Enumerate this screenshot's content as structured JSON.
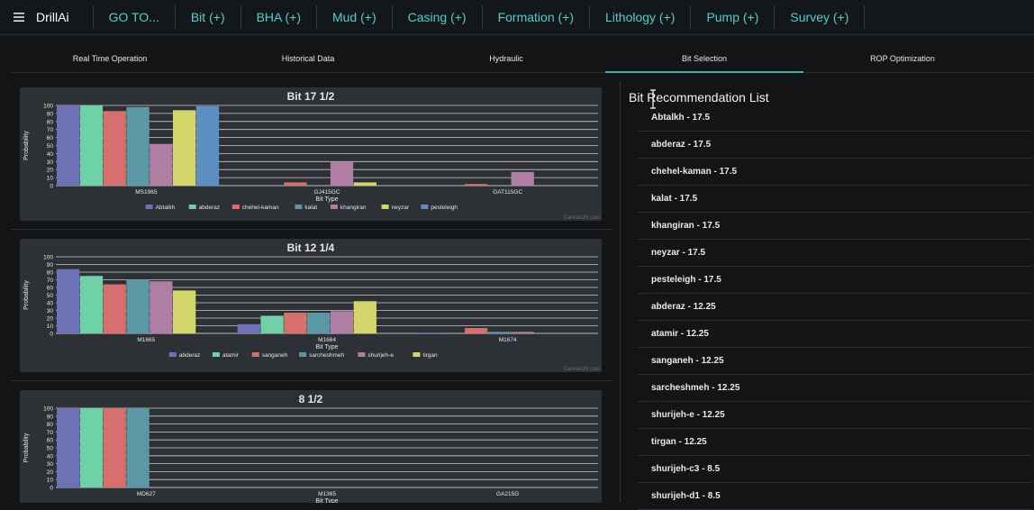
{
  "app": {
    "title": "DrillAi"
  },
  "nav": [
    "GO TO...",
    "Bit (+)",
    "BHA (+)",
    "Mud (+)",
    "Casing (+)",
    "Formation (+)",
    "Lithology (+)",
    "Pump (+)",
    "Survey (+)"
  ],
  "tabs": [
    "Real Time Operation",
    "Historical Data",
    "Hydraulic",
    "Bit Selection",
    "ROP Optimization"
  ],
  "active_tab": "Bit Selection",
  "recommendation": {
    "title": "Bit Recommendation List",
    "items": [
      "Abtalkh - 17.5",
      "abderaz - 17.5",
      "chehel-kaman - 17.5",
      "kalat - 17.5",
      "khangiran - 17.5",
      "neyzar - 17.5",
      "pesteleigh - 17.5",
      "abderaz - 12.25",
      "atamir - 12.25",
      "sanganeh - 12.25",
      "sarcheshmeh - 12.25",
      "shurijeh-e - 12.25",
      "tirgan - 12.25",
      "shurijeh-c3 - 8.5",
      "shurijeh-d1 - 8.5"
    ]
  },
  "colors": {
    "accent": "#4fd1c5",
    "tab_underline": "#38b2ac",
    "chart_bg": "#2d3135"
  },
  "chart_data": [
    {
      "type": "bar",
      "title": "Bit 17 1/2",
      "xlabel": "Bit Type",
      "ylabel": "Probability",
      "ylim": [
        0,
        100
      ],
      "yticks": [
        0,
        10,
        20,
        30,
        40,
        50,
        60,
        70,
        80,
        90,
        100
      ],
      "categories": [
        "MS1965",
        "GJ415GC",
        "GAT115GC"
      ],
      "series": [
        {
          "name": "Abtalkh",
          "color": "#6d72b7",
          "values": [
            100,
            0,
            0
          ]
        },
        {
          "name": "abderaz",
          "color": "#6fd1a7",
          "values": [
            100,
            0,
            0
          ]
        },
        {
          "name": "chehel-kaman",
          "color": "#d7706d",
          "values": [
            93,
            4,
            2
          ]
        },
        {
          "name": "kalat",
          "color": "#5a98a6",
          "values": [
            98,
            0,
            0
          ]
        },
        {
          "name": "khangiran",
          "color": "#b07ea3",
          "values": [
            52,
            30,
            17
          ]
        },
        {
          "name": "neyzar",
          "color": "#d3d66a",
          "values": [
            94,
            4,
            0
          ]
        },
        {
          "name": "pesteleigh",
          "color": "#5d8fc4",
          "values": [
            99,
            0,
            0
          ]
        }
      ],
      "watermark": "CanvasJS.com"
    },
    {
      "type": "bar",
      "title": "Bit 12 1/4",
      "xlabel": "Bit Type",
      "ylabel": "Probability",
      "ylim": [
        0,
        100
      ],
      "yticks": [
        0,
        10,
        20,
        30,
        40,
        50,
        60,
        70,
        80,
        90,
        100
      ],
      "categories": [
        "M1665",
        "M1664",
        "M1674"
      ],
      "series": [
        {
          "name": "abderaz",
          "color": "#6d72b7",
          "values": [
            84,
            12,
            1
          ]
        },
        {
          "name": "atamir",
          "color": "#6fd1a7",
          "values": [
            75,
            23,
            0
          ]
        },
        {
          "name": "sanganeh",
          "color": "#d7706d",
          "values": [
            64,
            27,
            7
          ]
        },
        {
          "name": "sarcheshmeh",
          "color": "#5a98a6",
          "values": [
            70,
            27,
            2
          ]
        },
        {
          "name": "shurijeh-e",
          "color": "#b07ea3",
          "values": [
            68,
            29,
            2
          ]
        },
        {
          "name": "tirgan",
          "color": "#d3d66a",
          "values": [
            56,
            42,
            0
          ]
        }
      ],
      "watermark": "CanvasJS.com"
    },
    {
      "type": "bar",
      "title": "8 1/2",
      "xlabel": "Bit Type",
      "ylabel": "Probability",
      "ylim": [
        0,
        100
      ],
      "yticks": [
        0,
        10,
        20,
        30,
        40,
        50,
        60,
        70,
        80,
        90,
        100
      ],
      "categories": [
        "MD627",
        "M1365",
        "GA215G"
      ],
      "series": [
        {
          "name": "",
          "color": "#6d72b7",
          "values": [
            100,
            0,
            0
          ]
        },
        {
          "name": "",
          "color": "#6fd1a7",
          "values": [
            100,
            0,
            0
          ]
        },
        {
          "name": "",
          "color": "#d7706d",
          "values": [
            100,
            0,
            0
          ]
        },
        {
          "name": "",
          "color": "#5a98a6",
          "values": [
            100,
            0,
            0
          ]
        }
      ]
    }
  ]
}
